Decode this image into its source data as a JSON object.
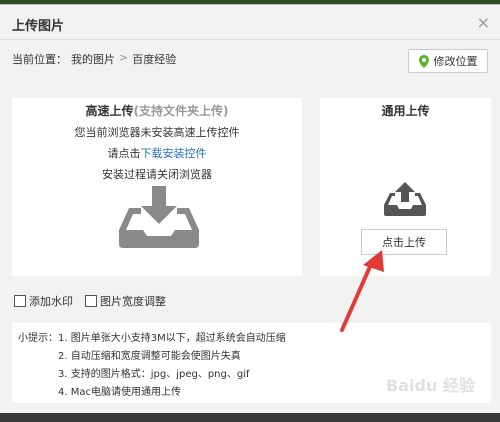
{
  "dialog": {
    "title": "上传图片",
    "close_glyph": "×"
  },
  "location": {
    "prefix": "当前位置：",
    "crumb1": "我的图片",
    "separator": ">",
    "crumb2": "百度经验",
    "button_label": "修改位置",
    "icon": "location-pin-icon",
    "icon_color": "#5cb531"
  },
  "fast_upload": {
    "title": "高速上传",
    "title_note": "(支持文件夹上传)",
    "line1": "您当前浏览器未安装高速上传控件",
    "line2_prefix": "请点击",
    "line2_link": "下载安装控件",
    "line3": "安装过程请关闭浏览器",
    "icon": "inbox-download-icon"
  },
  "general_upload": {
    "title": "通用上传",
    "button_label": "点击上传",
    "icon": "inbox-upload-icon"
  },
  "options": {
    "watermark": "添加水印",
    "width_adjust": "图片宽度调整"
  },
  "tips": {
    "label": "小提示：",
    "items": [
      "1. 图片单张大小支持3M以下，超过系统会自动压缩",
      "2. 自动压缩和宽度调整可能会使图片失真",
      "3. 支持的图片格式：jpg、jpeg、png、gif",
      "4. Mac电脑请使用通用上传"
    ]
  },
  "annotation": {
    "color": "#e53935"
  },
  "watermark_text": "Baidu 经验"
}
